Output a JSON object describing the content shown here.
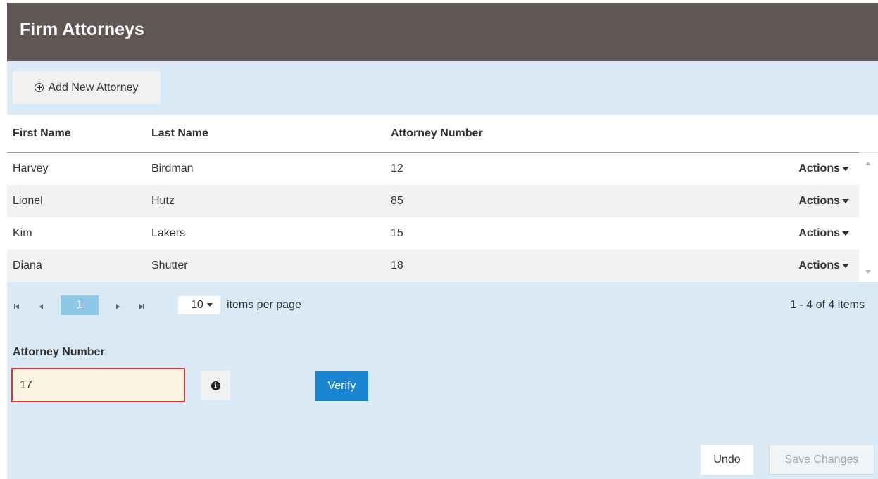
{
  "header": {
    "title": "Firm Attorneys"
  },
  "toolbar": {
    "add_label": "Add New Attorney"
  },
  "grid": {
    "columns": [
      "First Name",
      "Last Name",
      "Attorney Number"
    ],
    "rows": [
      {
        "first": "Harvey",
        "last": "Birdman",
        "number": "12",
        "actions": "Actions"
      },
      {
        "first": "Lionel",
        "last": "Hutz",
        "number": "85",
        "actions": "Actions"
      },
      {
        "first": "Kim",
        "last": "Lakers",
        "number": "15",
        "actions": "Actions"
      },
      {
        "first": "Diana",
        "last": "Shutter",
        "number": "18",
        "actions": "Actions"
      }
    ]
  },
  "pager": {
    "current_page": "1",
    "page_size": "10",
    "page_size_label": "items per page",
    "info": "1 - 4 of 4 items"
  },
  "form": {
    "label": "Attorney Number",
    "value": "17",
    "verify_label": "Verify"
  },
  "footer": {
    "undo_label": "Undo",
    "save_label": "Save Changes"
  },
  "colors": {
    "header_bg": "#615656",
    "panel_bg": "#d9e9f5",
    "primary": "#1a85d0",
    "error_border": "#d9383a",
    "page_active": "#8ec8e6"
  }
}
